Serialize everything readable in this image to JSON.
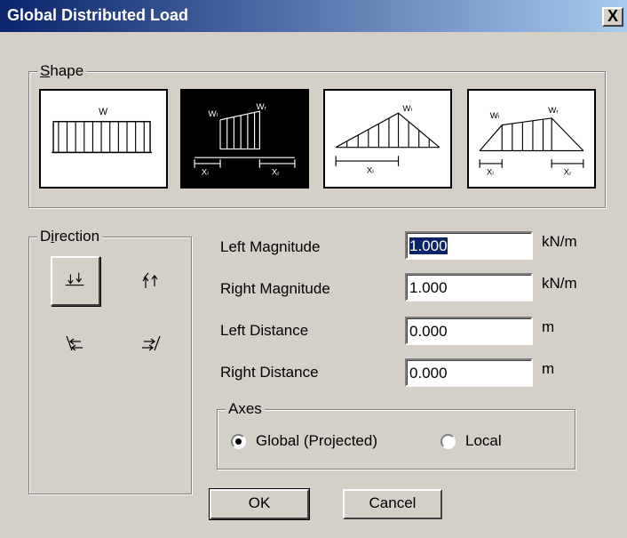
{
  "window": {
    "title": "Global Distributed Load",
    "close_glyph": "X"
  },
  "shape": {
    "label": "Shape",
    "options": [
      {
        "name": "uniform",
        "labels": [
          "W"
        ]
      },
      {
        "name": "partial-trapezoid",
        "labels": [
          "Wₗ",
          "Wᵣ",
          "Xₗ",
          "Xᵣ"
        ],
        "selected": true
      },
      {
        "name": "triangle",
        "labels": [
          "Wₗ",
          "Xₗ"
        ]
      },
      {
        "name": "trapezoid",
        "labels": [
          "Wₗ",
          "Wᵣ",
          "Xₗ",
          "Xᵣ"
        ]
      }
    ]
  },
  "direction": {
    "label": "Direction",
    "options": [
      {
        "name": "gravity-down",
        "selected": true
      },
      {
        "name": "upward"
      },
      {
        "name": "left-diagonal"
      },
      {
        "name": "right-diagonal"
      }
    ]
  },
  "fields": {
    "left_magnitude": {
      "label": "Left Magnitude",
      "value": "1.000",
      "unit": "kN/m"
    },
    "right_magnitude": {
      "label": "Right Magnitude",
      "value": "1.000",
      "unit": "kN/m"
    },
    "left_distance": {
      "label": "Left Distance",
      "value": "0.000",
      "unit": "m"
    },
    "right_distance": {
      "label": "Right Distance",
      "value": "0.000",
      "unit": "m"
    }
  },
  "axes": {
    "label": "Axes",
    "global_label": "Global (Projected)",
    "local_label": "Local",
    "selected": "global"
  },
  "buttons": {
    "ok": "OK",
    "cancel": "Cancel"
  },
  "colors": {
    "title_start": "#0a246a",
    "title_end": "#a6caf0",
    "face": "#d4d0c8",
    "selection": "#0a246a"
  }
}
